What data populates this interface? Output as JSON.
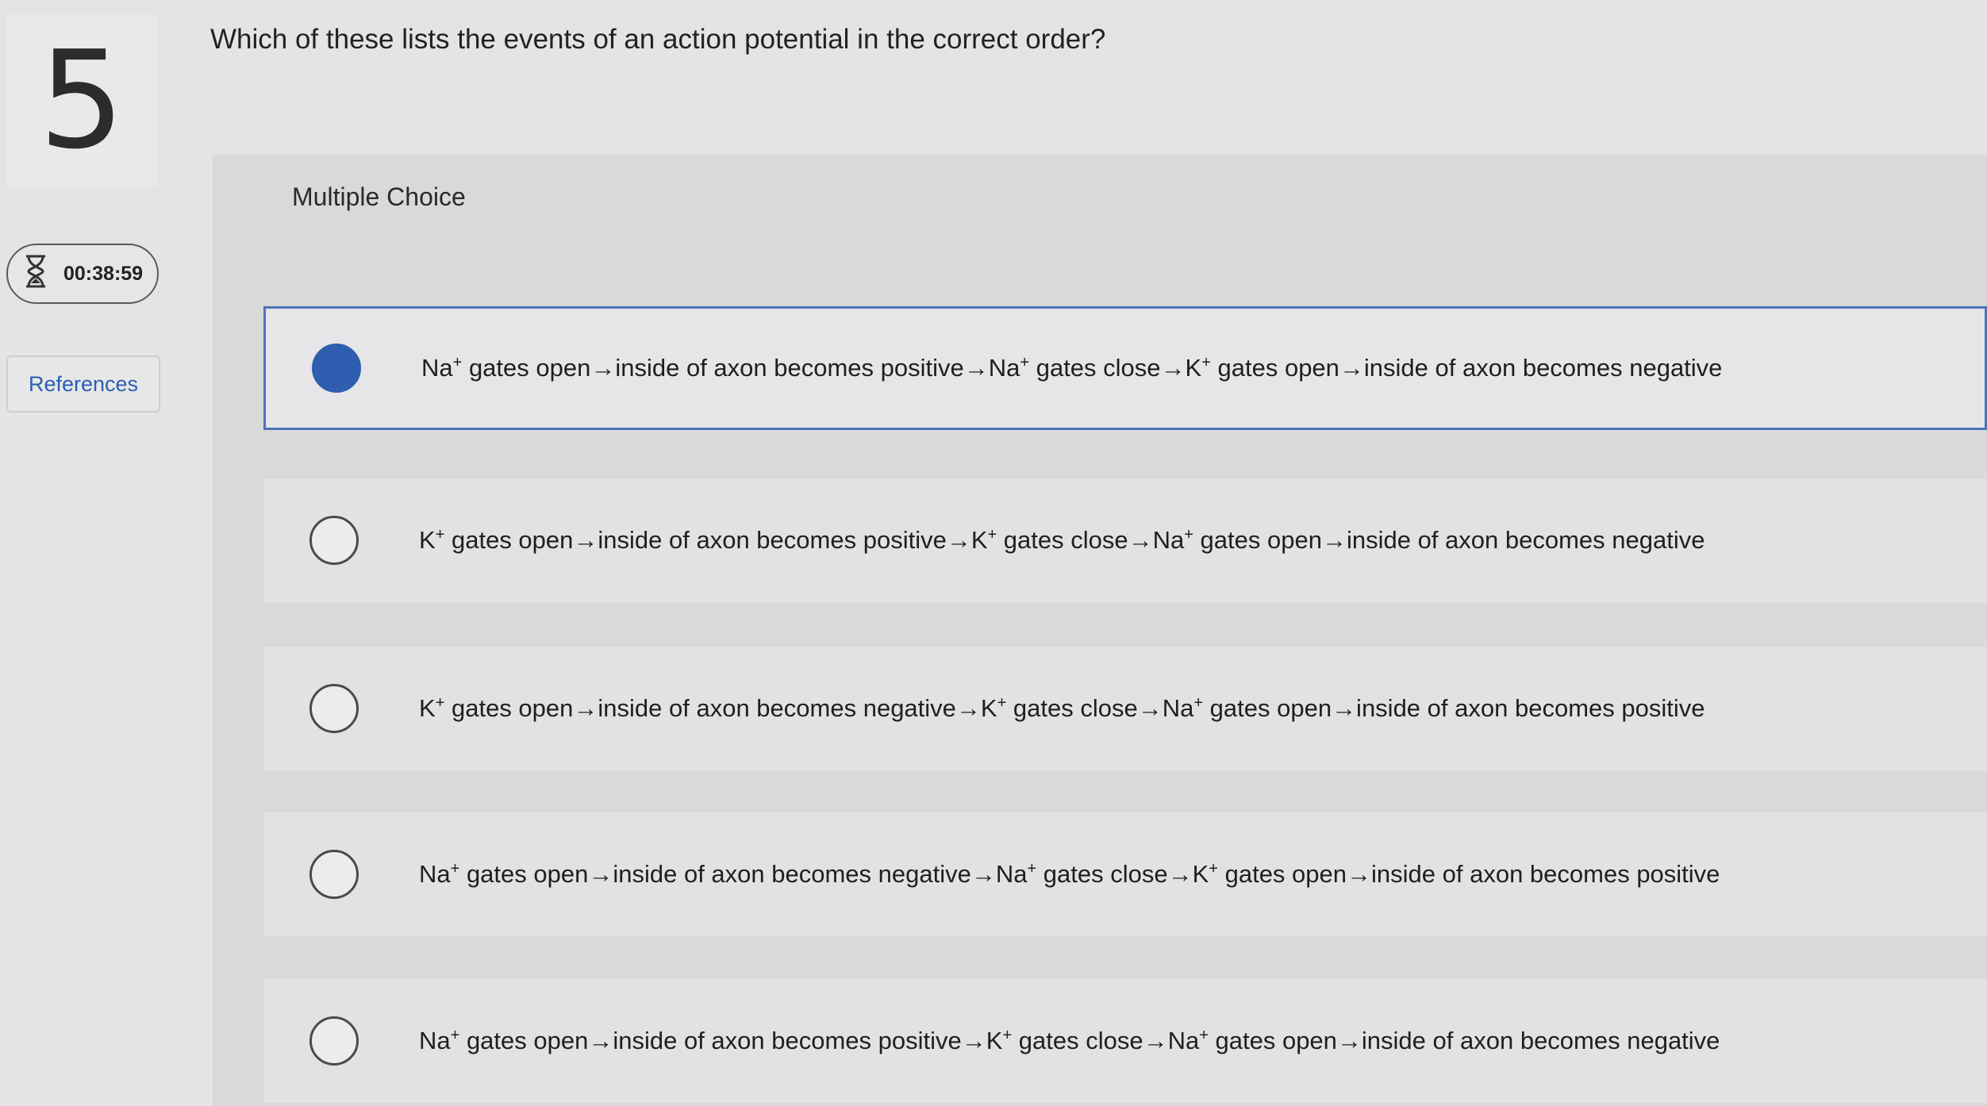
{
  "sidebar": {
    "question_number": "5",
    "timer": "00:38:59",
    "references_label": "References"
  },
  "question": {
    "text": "Which of these lists the events of an action potential in the correct order?",
    "type_label": "Multiple Choice"
  },
  "options": [
    {
      "selected": true,
      "parts": {
        "p1": "Na",
        "s1": "+",
        "p2": " gates open→inside of axon becomes positive→Na",
        "s2": "+",
        "p3": " gates close→K",
        "s3": "+",
        "p4": " gates open→inside of axon becomes negative"
      }
    },
    {
      "selected": false,
      "parts": {
        "p1": "K",
        "s1": "+",
        "p2": " gates open→inside of axon becomes positive→K",
        "s2": "+",
        "p3": " gates close→Na",
        "s3": "+",
        "p4": " gates open→inside of axon becomes negative"
      }
    },
    {
      "selected": false,
      "parts": {
        "p1": "K",
        "s1": "+",
        "p2": " gates open→inside of axon becomes negative→K",
        "s2": "+",
        "p3": " gates close→Na",
        "s3": "+",
        "p4": " gates open→inside of axon becomes positive"
      }
    },
    {
      "selected": false,
      "parts": {
        "p1": "Na",
        "s1": "+",
        "p2": " gates open→inside of axon becomes negative→Na",
        "s2": "+",
        "p3": " gates close→K",
        "s3": "+",
        "p4": " gates open→inside of axon becomes positive"
      }
    },
    {
      "selected": false,
      "parts": {
        "p1": "Na",
        "s1": "+",
        "p2": " gates open→inside of axon becomes positive→K",
        "s2": "+",
        "p3": " gates close→Na",
        "s3": "+",
        "p4": " gates open→inside of axon becomes negative"
      }
    }
  ],
  "colors": {
    "accent": "#2f5eb0",
    "link": "#2b5eb4"
  }
}
